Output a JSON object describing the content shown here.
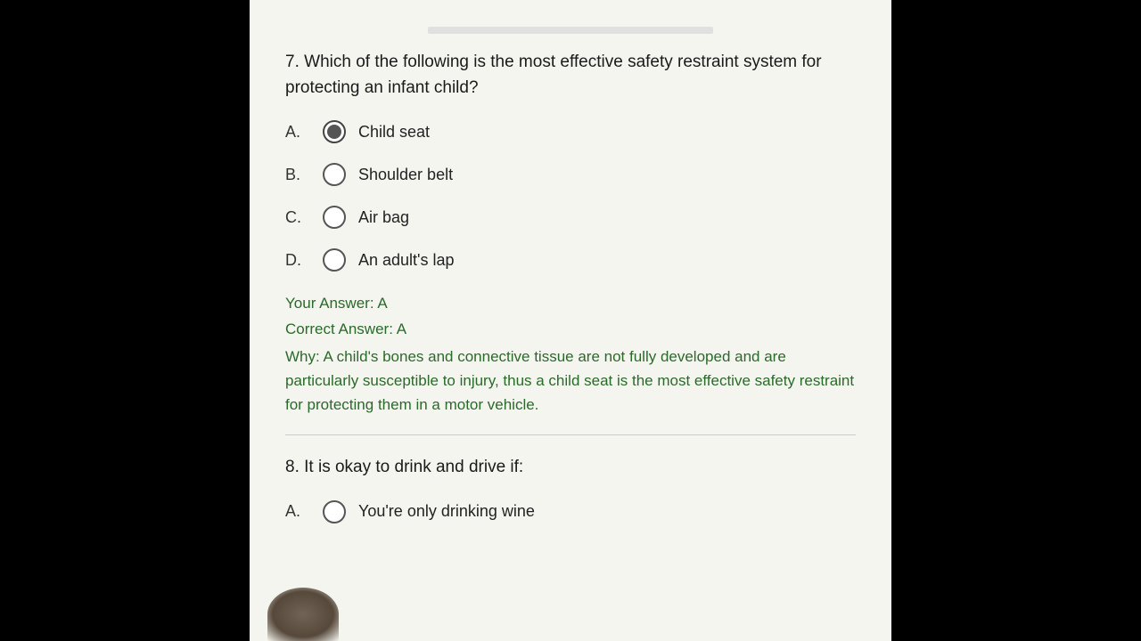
{
  "colors": {
    "background": "#000000",
    "screen_bg": "#f5f5f0",
    "text_dark": "#1a1a1a",
    "text_answer": "#2a6a2a",
    "radio_fill": "#555555"
  },
  "question7": {
    "number": "7.",
    "text": "Which of the following is the most effective safety restraint system for protecting an infant child?",
    "options": [
      {
        "label": "A.",
        "text": "Child seat",
        "selected": true
      },
      {
        "label": "B.",
        "text": "Shoulder belt",
        "selected": false
      },
      {
        "label": "C.",
        "text": "Air bag",
        "selected": false
      },
      {
        "label": "D.",
        "text": "An adult's lap",
        "selected": false
      }
    ],
    "your_answer_label": "Your Answer: A",
    "correct_answer_label": "Correct Answer: A",
    "why_label": "Why:",
    "why_text": "A child's bones and connective tissue are not fully developed and are particularly susceptible to injury, thus a child seat is the most effective safety restraint for protecting them in a motor vehicle."
  },
  "question8": {
    "number": "8.",
    "text": "It is okay to drink and drive if:",
    "options": [
      {
        "label": "A.",
        "text": "You're only drinking wine",
        "selected": false
      }
    ]
  }
}
